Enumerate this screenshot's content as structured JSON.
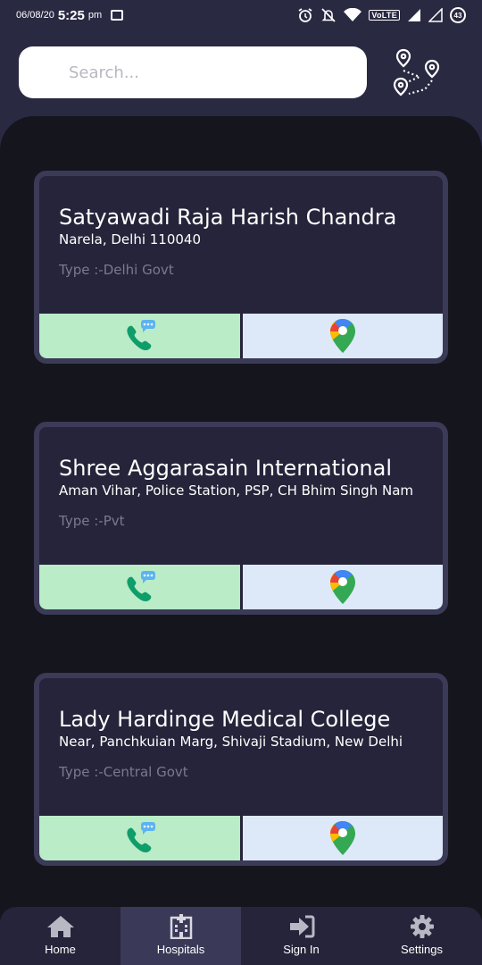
{
  "status_bar": {
    "date": "06/08/20",
    "time": "5:25",
    "ampm": "pm",
    "network": "VoLTE",
    "battery": "43"
  },
  "search": {
    "placeholder": "Search..."
  },
  "hospitals": [
    {
      "name": "Satyawadi Raja Harish Chandra",
      "address": "Narela, Delhi 110040",
      "type": "Type :-Delhi Govt"
    },
    {
      "name": "Shree Aggarasain International",
      "address": "Aman Vihar, Police Station, PSP, CH Bhim Singh Nam",
      "type": "Type :-Pvt"
    },
    {
      "name": "Lady Hardinge Medical College",
      "address": "Near, Panchkuian Marg, Shivaji Stadium, New Delhi",
      "type": "Type :-Central Govt"
    }
  ],
  "nav": [
    {
      "label": "Home",
      "icon": "home-icon"
    },
    {
      "label": "Hospitals",
      "icon": "hospital-icon",
      "active": true
    },
    {
      "label": "Sign In",
      "icon": "sign-in-icon"
    },
    {
      "label": "Settings",
      "icon": "gear-icon"
    }
  ],
  "colors": {
    "background": "#2a2942",
    "panel": "#15151e",
    "card": "#25243a",
    "card_border": "#3b3a57",
    "call_button": "#b9ecc7",
    "map_button": "#dde9f9",
    "phone_green": "#0f9d6a",
    "nav_active": "#3a3958"
  }
}
